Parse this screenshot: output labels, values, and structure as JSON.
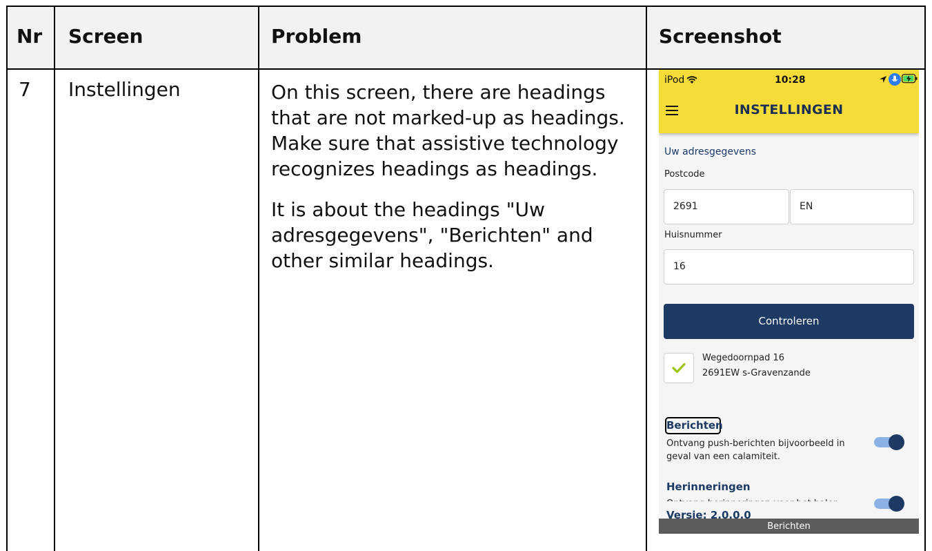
{
  "table": {
    "headers": {
      "nr": "Nr",
      "screen": "Screen",
      "problem": "Problem",
      "screenshot": "Screenshot"
    },
    "row": {
      "nr": "7",
      "screen": "Instellingen",
      "problem_paragraphs": [
        "On this screen, there are headings that are not marked-up as headings. Make sure that assistive technology recognizes headings as headings.",
        "It is about the headings \"Uw adresgegevens\", \"Berichten\" and other similar headings."
      ]
    }
  },
  "phone": {
    "status": {
      "carrier": "iPod",
      "time": "10:28"
    },
    "app_title": "INSTELLINGEN",
    "address_section_title": "Uw adresgegevens",
    "postcode_label": "Postcode",
    "postcode_numbers": "2691",
    "postcode_letters": "EN",
    "house_number_label": "Huisnummer",
    "house_number": "16",
    "check_button": "Controleren",
    "verified_address_line1": "Wegedoornpad 16",
    "verified_address_line2": "2691EW s-Gravenzande",
    "messages_heading": "Berichten",
    "messages_description": "Ontvang push-berichten bijvoorbeeld in geval van een calamiteit.",
    "reminders_heading": "Herinneringen",
    "reminders_description": "Ontvang herinneringen voor het halen",
    "version_partial": "Versie: 2.0.0.0",
    "tab_label": "Berichten",
    "colors": {
      "appbar": "#f5dc38",
      "primary": "#1c3a63",
      "toggle_track": "#8cb2e5",
      "check": "#9ac40e"
    }
  }
}
